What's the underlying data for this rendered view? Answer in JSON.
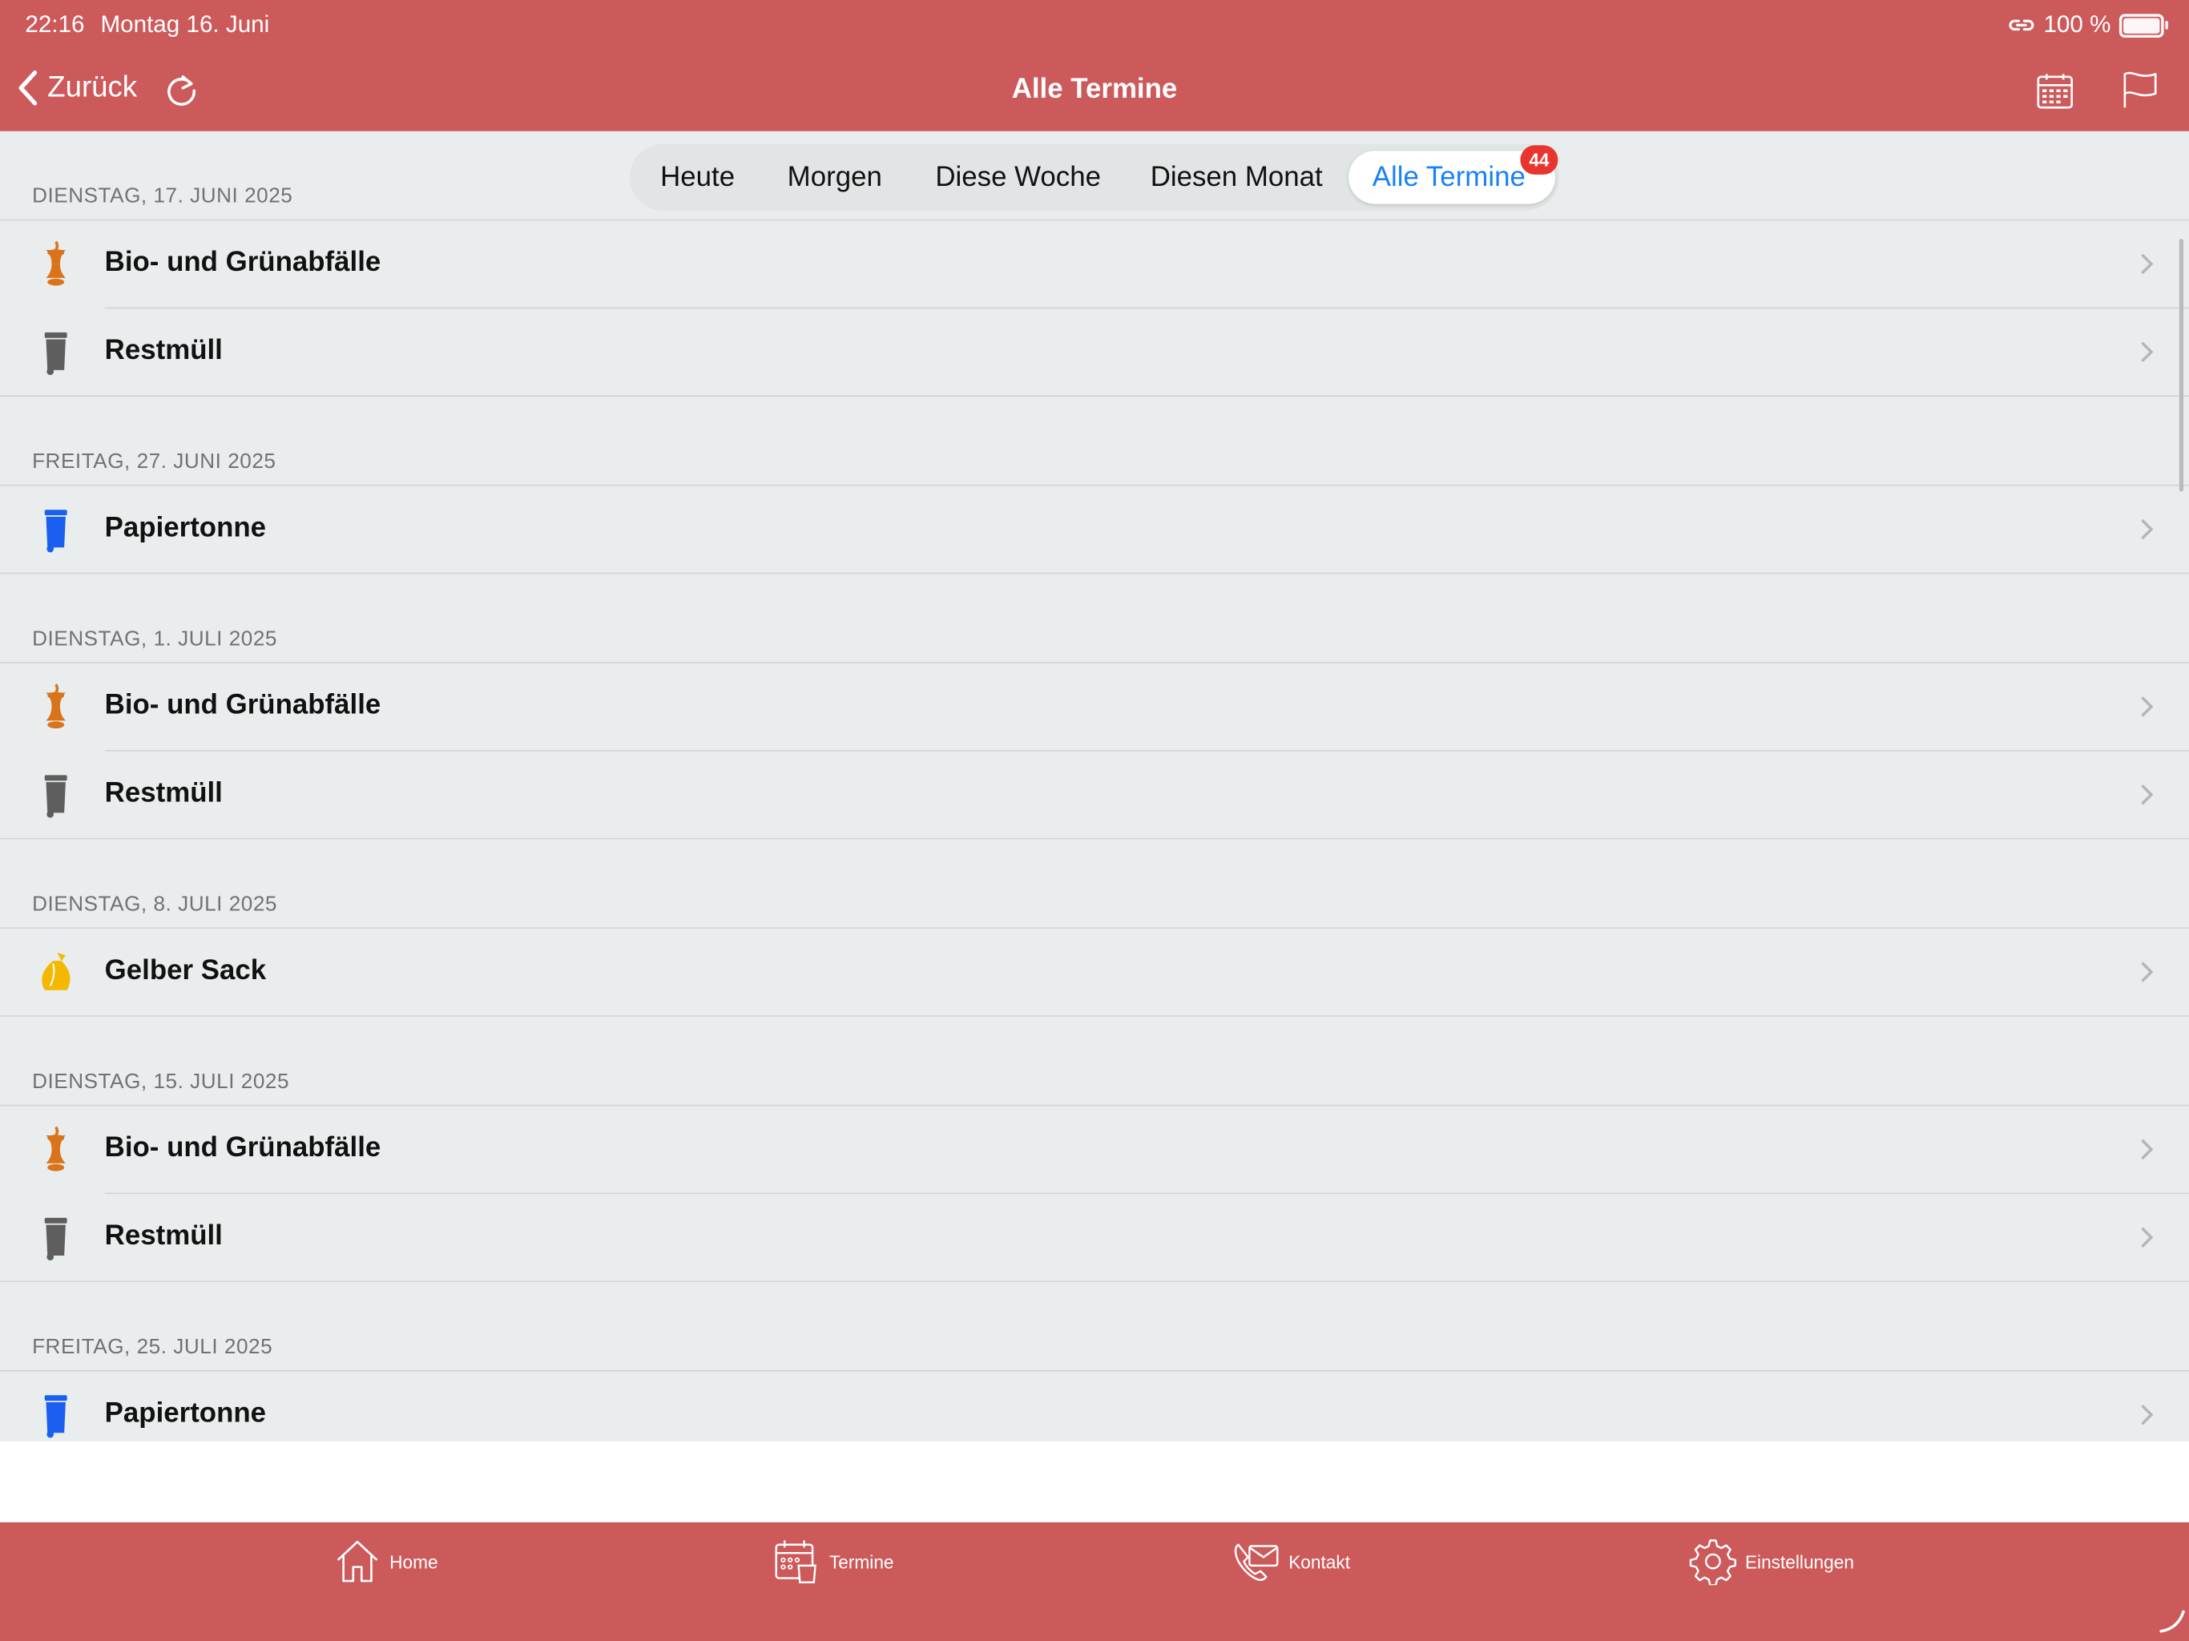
{
  "status_bar": {
    "time": "22:16",
    "date": "Montag 16. Juni",
    "battery_text": "100 %",
    "battery_level": 1.0
  },
  "nav": {
    "back_label": "Zurück",
    "title": "Alle Termine",
    "icons": [
      "chevron-left-icon",
      "refresh-icon",
      "calendar-icon",
      "flag-icon"
    ]
  },
  "segments": {
    "items": [
      "Heute",
      "Morgen",
      "Diese Woche",
      "Diesen Monat",
      "Alle Termine"
    ],
    "selected": "Alle Termine",
    "badge": "44"
  },
  "sections": [
    {
      "date": "DIENSTAG, 17. JUNI 2025",
      "items": [
        "Bio- und Grünabfälle",
        "Restmüll"
      ]
    },
    {
      "date": "FREITAG, 27. JUNI 2025",
      "items": [
        "Papiertonne"
      ]
    },
    {
      "date": "DIENSTAG, 1. JULI 2025",
      "items": [
        "Bio- und Grünabfälle",
        "Restmüll"
      ]
    },
    {
      "date": "DIENSTAG, 8. JULI 2025",
      "items": [
        "Gelber Sack"
      ]
    },
    {
      "date": "DIENSTAG, 15. JULI 2025",
      "items": [
        "Bio- und Grünabfälle",
        "Restmüll"
      ]
    },
    {
      "date": "FREITAG, 25. JULI 2025",
      "items": [
        "Papiertonne"
      ]
    }
  ],
  "tabbar": {
    "home": "Home",
    "termine": "Termine",
    "kontakt": "Kontakt",
    "einstellungen": "Einstellungen"
  },
  "colors": {
    "brand_red": "#cd5a5b",
    "list_background": "#eaedee",
    "active_blue": "#1a82f5",
    "badge_red": "#e8352f",
    "bio_orange": "#d9741b",
    "restmuell_gray": "#5e5e5e",
    "papier_blue": "#1a5ff0",
    "gelber_sack_yellow": "#f5b800"
  }
}
